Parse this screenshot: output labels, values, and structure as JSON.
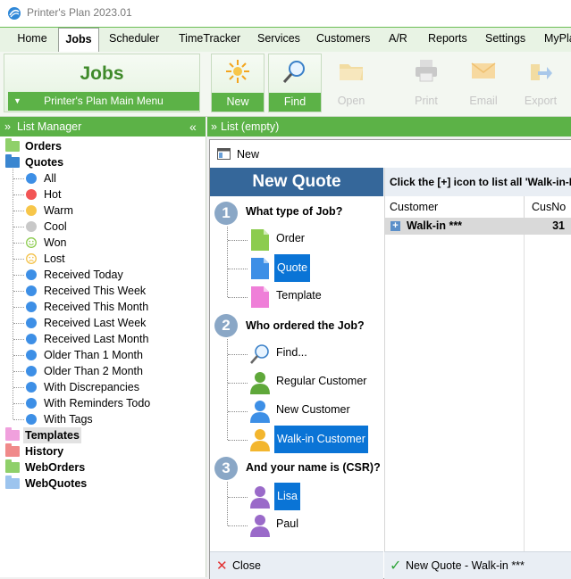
{
  "window": {
    "title": "Printer's Plan 2023.01"
  },
  "menu": [
    {
      "label": "Home",
      "active": false
    },
    {
      "label": "Jobs",
      "active": true
    },
    {
      "label": "Scheduler",
      "active": false
    },
    {
      "label": "TimeTracker",
      "active": false
    },
    {
      "label": "Services",
      "active": false
    },
    {
      "label": "Customers",
      "active": false
    },
    {
      "label": "A/R",
      "active": false
    },
    {
      "label": "Reports",
      "active": false
    },
    {
      "label": "Settings",
      "active": false
    },
    {
      "label": "MyPla",
      "active": false
    }
  ],
  "ribbon": {
    "group_title": "Jobs",
    "main_menu": "Printer's Plan Main Menu",
    "buttons": [
      {
        "label": "New",
        "icon": "sun-icon",
        "enabled": true
      },
      {
        "label": "Find",
        "icon": "magnifier-icon",
        "enabled": true
      },
      {
        "label": "Open",
        "icon": "folder-icon",
        "enabled": false
      },
      {
        "label": "Print",
        "icon": "printer-icon",
        "enabled": false
      },
      {
        "label": "Email",
        "icon": "envelope-icon",
        "enabled": false
      },
      {
        "label": "Export",
        "icon": "export-icon",
        "enabled": false
      }
    ]
  },
  "list_manager": {
    "header": "List Manager",
    "collapse_glyph": "«",
    "expand_glyph": "»",
    "items": [
      {
        "label": "Orders",
        "kind": "folder",
        "color": "#8fd06a",
        "level": 0,
        "bold": true
      },
      {
        "label": "Quotes",
        "kind": "folder",
        "color": "#3a86d0",
        "level": 0,
        "bold": true
      },
      {
        "label": "All",
        "kind": "dot",
        "color": "#3d8fe6",
        "level": 1
      },
      {
        "label": "Hot",
        "kind": "dot",
        "color": "#f25555",
        "level": 1
      },
      {
        "label": "Warm",
        "kind": "dot",
        "color": "#f7c64a",
        "level": 1
      },
      {
        "label": "Cool",
        "kind": "dot",
        "color": "#c8c8c8",
        "level": 1
      },
      {
        "label": "Won",
        "kind": "smile",
        "color": "#8ccc4e",
        "level": 1
      },
      {
        "label": "Lost",
        "kind": "frown",
        "color": "#f3c24b",
        "level": 1
      },
      {
        "label": "Received Today",
        "kind": "dot",
        "color": "#3d8fe6",
        "level": 1
      },
      {
        "label": "Received This Week",
        "kind": "dot",
        "color": "#3d8fe6",
        "level": 1
      },
      {
        "label": "Received This Month",
        "kind": "dot",
        "color": "#3d8fe6",
        "level": 1
      },
      {
        "label": "Received Last Week",
        "kind": "dot",
        "color": "#3d8fe6",
        "level": 1
      },
      {
        "label": "Received Last Month",
        "kind": "dot",
        "color": "#3d8fe6",
        "level": 1
      },
      {
        "label": "Older Than 1 Month",
        "kind": "dot",
        "color": "#3d8fe6",
        "level": 1
      },
      {
        "label": "Older Than 2 Month",
        "kind": "dot",
        "color": "#3d8fe6",
        "level": 1
      },
      {
        "label": "With Discrepancies",
        "kind": "dot",
        "color": "#3d8fe6",
        "level": 1
      },
      {
        "label": "With Reminders Todo",
        "kind": "dot",
        "color": "#3d8fe6",
        "level": 1
      },
      {
        "label": "With Tags",
        "kind": "dot",
        "color": "#3d8fe6",
        "level": 1
      },
      {
        "label": "Templates",
        "kind": "folder",
        "color": "#f0a0dd",
        "level": 0,
        "bold": true,
        "selected": true
      },
      {
        "label": "History",
        "kind": "folder",
        "color": "#f08a8a",
        "level": 0,
        "bold": true
      },
      {
        "label": "WebOrders",
        "kind": "folder",
        "color": "#8fd06a",
        "level": 0,
        "bold": true
      },
      {
        "label": "WebQuotes",
        "kind": "folder",
        "color": "#9cc4ee",
        "level": 0,
        "bold": true
      }
    ]
  },
  "list": {
    "header": "List (empty)",
    "expand_glyph": "»"
  },
  "dialog": {
    "title": "New",
    "heading": "New Quote",
    "steps": [
      {
        "num": "1",
        "question": "What type of Job?",
        "options": [
          {
            "label": "Order",
            "icon": "order-doc-icon",
            "selected": false
          },
          {
            "label": "Quote",
            "icon": "quote-doc-icon",
            "selected": true
          },
          {
            "label": "Template",
            "icon": "template-doc-icon",
            "selected": false
          }
        ]
      },
      {
        "num": "2",
        "question": "Who ordered the Job?",
        "options": [
          {
            "label": "Find...",
            "icon": "magnifier-icon",
            "selected": false
          },
          {
            "label": "Regular Customer",
            "icon": "person-green-icon",
            "selected": false
          },
          {
            "label": "New Customer",
            "icon": "person-blue-icon",
            "selected": false
          },
          {
            "label": "Walk-in Customer",
            "icon": "person-yellow-icon",
            "selected": true
          }
        ]
      },
      {
        "num": "3",
        "question": "And your name is (CSR)?",
        "options": [
          {
            "label": "Lisa",
            "icon": "person-purple-icon",
            "selected": true
          },
          {
            "label": "Paul",
            "icon": "person-purple-icon",
            "selected": false
          }
        ]
      }
    ],
    "hint": "Click the [+] icon to list all 'Walk-in-B",
    "grid": {
      "columns": [
        "Customer",
        "CusNo"
      ],
      "rows": [
        {
          "customer": "Walk-in ***",
          "cusno": "31"
        }
      ]
    },
    "close_label": "Close",
    "ok_label": "New Quote - Walk-in ***"
  },
  "colors": {
    "accent_green": "#5cb247",
    "dialog_blue": "#35679a",
    "selection_blue": "#0a74d6"
  }
}
